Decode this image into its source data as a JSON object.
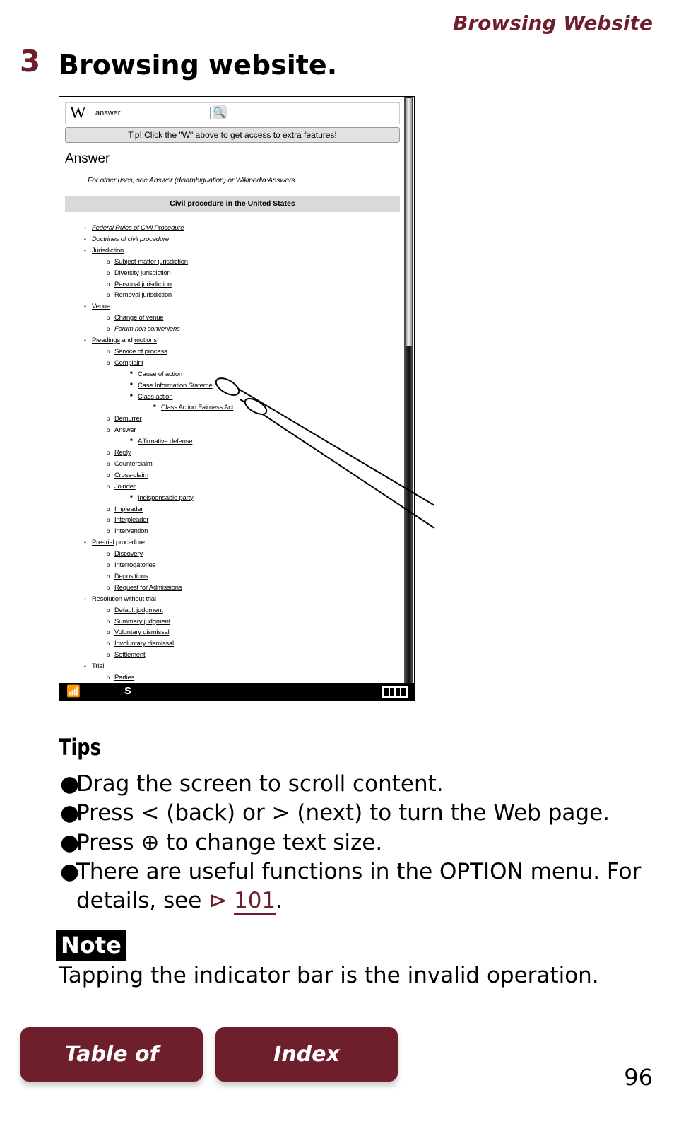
{
  "header": {
    "section": "Browsing Website"
  },
  "step": {
    "number": "3",
    "title": "Browsing website."
  },
  "screen": {
    "logo": "W",
    "search_value": "answer",
    "search_icon": "magnifier-icon",
    "tip": "Tip! Click the \"W\" above to get access to extra features!",
    "heading": "Answer",
    "other_uses": [
      {
        "t": "For other uses, see "
      },
      {
        "t": "Answer (disambiguation)",
        "link": true
      },
      {
        "t": " or "
      },
      {
        "t": "Wikipedia:Answers",
        "link": true
      },
      {
        "t": "."
      }
    ],
    "navbox": [
      {
        "t": "Civil procedure",
        "link": true
      },
      {
        "t": " in the "
      },
      {
        "t": "United States",
        "link": true
      }
    ],
    "items": [
      {
        "l": 1,
        "s": [
          {
            "t": "Federal Rules of Civil Procedure",
            "link": true,
            "i": true
          }
        ]
      },
      {
        "l": 1,
        "s": [
          {
            "t": "Doctrines of civil procedure",
            "link": true,
            "i": true
          }
        ]
      },
      {
        "l": 1,
        "s": [
          {
            "t": "Jurisdiction",
            "link": true
          }
        ]
      },
      {
        "l": 2,
        "s": [
          {
            "t": "Subject-matter jurisdiction",
            "link": true
          }
        ]
      },
      {
        "l": 2,
        "s": [
          {
            "t": "Diversity jurisdiction",
            "link": true
          }
        ]
      },
      {
        "l": 2,
        "s": [
          {
            "t": "Personal jurisdiction",
            "link": true
          }
        ]
      },
      {
        "l": 2,
        "s": [
          {
            "t": "Removal jurisdiction",
            "link": true
          }
        ]
      },
      {
        "l": 1,
        "s": [
          {
            "t": "Venue",
            "link": true
          }
        ]
      },
      {
        "l": 2,
        "s": [
          {
            "t": "Change of venue",
            "link": true
          }
        ]
      },
      {
        "l": 2,
        "s": [
          {
            "t": "Forum non conveniens",
            "link": true,
            "i": true
          }
        ]
      },
      {
        "l": 1,
        "s": [
          {
            "t": "Pleadings",
            "link": true
          },
          {
            "t": " and "
          },
          {
            "t": "motions",
            "link": true
          }
        ]
      },
      {
        "l": 2,
        "s": [
          {
            "t": "Service of process",
            "link": true
          }
        ]
      },
      {
        "l": 2,
        "s": [
          {
            "t": "Complaint",
            "link": true
          }
        ]
      },
      {
        "l": 3,
        "s": [
          {
            "t": "Cause of action",
            "link": true
          }
        ]
      },
      {
        "l": 3,
        "s": [
          {
            "t": "Case Information Stateme",
            "link": true
          }
        ]
      },
      {
        "l": 3,
        "s": [
          {
            "t": "Class action",
            "link": true
          }
        ]
      },
      {
        "l": 4,
        "s": [
          {
            "t": "Class Action Fairness Act",
            "link": true
          }
        ]
      },
      {
        "l": 2,
        "s": [
          {
            "t": "Demurrer",
            "link": true
          }
        ]
      },
      {
        "l": 2,
        "s": [
          {
            "t": "Answer"
          }
        ]
      },
      {
        "l": 3,
        "s": [
          {
            "t": "Affirmative defense",
            "link": true
          }
        ]
      },
      {
        "l": 2,
        "s": [
          {
            "t": "Reply",
            "link": true
          }
        ]
      },
      {
        "l": 2,
        "s": [
          {
            "t": "Counterclaim",
            "link": true
          }
        ]
      },
      {
        "l": 2,
        "s": [
          {
            "t": "Cross-claim",
            "link": true
          }
        ]
      },
      {
        "l": 2,
        "s": [
          {
            "t": "Joinder",
            "link": true
          }
        ]
      },
      {
        "l": 3,
        "s": [
          {
            "t": "Indispensable party",
            "link": true
          }
        ]
      },
      {
        "l": 2,
        "s": [
          {
            "t": "Impleader",
            "link": true
          }
        ]
      },
      {
        "l": 2,
        "s": [
          {
            "t": "Interpleader",
            "link": true
          }
        ]
      },
      {
        "l": 2,
        "s": [
          {
            "t": "Intervention",
            "link": true
          }
        ]
      },
      {
        "l": 1,
        "s": [
          {
            "t": "Pre-trial",
            "link": true
          },
          {
            "t": " procedure"
          }
        ]
      },
      {
        "l": 2,
        "s": [
          {
            "t": "Discovery",
            "link": true
          }
        ]
      },
      {
        "l": 2,
        "s": [
          {
            "t": "Interrogatories",
            "link": true
          }
        ]
      },
      {
        "l": 2,
        "s": [
          {
            "t": "Depositions",
            "link": true
          }
        ]
      },
      {
        "l": 2,
        "s": [
          {
            "t": "Request for Admissions",
            "link": true
          }
        ]
      },
      {
        "l": 1,
        "s": [
          {
            "t": "Resolution without trial"
          }
        ]
      },
      {
        "l": 2,
        "s": [
          {
            "t": "Default judgment",
            "link": true
          }
        ]
      },
      {
        "l": 2,
        "s": [
          {
            "t": "Summary judgment",
            "link": true
          }
        ]
      },
      {
        "l": 2,
        "s": [
          {
            "t": "Voluntary dismissal",
            "link": true
          }
        ]
      },
      {
        "l": 2,
        "s": [
          {
            "t": "Involuntary dismissal",
            "link": true
          }
        ]
      },
      {
        "l": 2,
        "s": [
          {
            "t": "Settlement",
            "link": true
          }
        ]
      },
      {
        "l": 1,
        "s": [
          {
            "t": "Trial",
            "link": true
          }
        ]
      },
      {
        "l": 2,
        "s": [
          {
            "t": "Parties",
            "link": true
          }
        ]
      }
    ],
    "status": {
      "wifi_icon": "wifi-icon",
      "s_label": "S",
      "battery_icon": "battery-icon"
    }
  },
  "tips": {
    "heading": "Tips",
    "line1": "Drag the screen to scroll content.",
    "line2": "Press < (back) or > (next) to turn the Web page.",
    "line3a": "Press ",
    "line3b": " to change text size.",
    "line4": "There are useful functions in the OPTION menu. For",
    "line4b": "details, see ",
    "ref": "101",
    "ref_end": "."
  },
  "note": {
    "label": "Note",
    "text": "Tapping the indicator bar is the invalid operation."
  },
  "footer": {
    "toc": "Table of Contents",
    "index": "Index",
    "page": "96"
  },
  "colors": {
    "accent": "#6e1f2b"
  }
}
